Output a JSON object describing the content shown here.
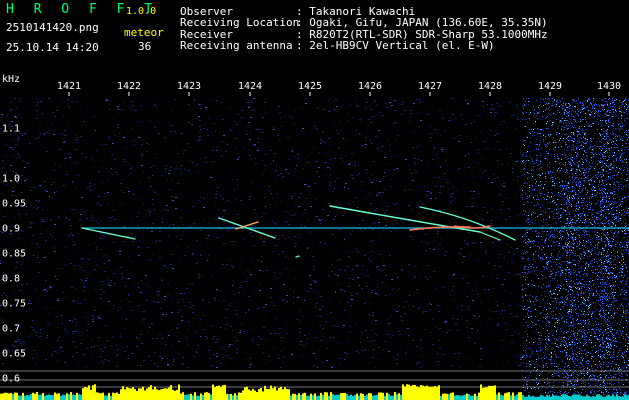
{
  "header": {
    "app_name": "H R O F F T",
    "version": "1.0.0",
    "filename": "2510141420.png",
    "timestamp": "25.10.14 14:20",
    "event_type": "meteor",
    "event_count": "36"
  },
  "info": [
    {
      "label": "Observer",
      "value": ": Takanori Kawachi"
    },
    {
      "label": "Receiving Location",
      "value": ": Ogaki, Gifu, JAPAN (136.60E, 35.35N)"
    },
    {
      "label": "Receiver",
      "value": ": R820T2(RTL-SDR) SDR-Sharp 53.1000MHz"
    },
    {
      "label": "Receiving antenna",
      "value": ": 2el-HB9CV Vertical (el. E-W)"
    }
  ],
  "axes": {
    "unit_label": "kHz",
    "x_ticks": [
      "1421",
      "1422",
      "1423",
      "1424",
      "1425",
      "1426",
      "1427",
      "1428",
      "1429",
      "1430"
    ],
    "y_ticks": [
      "1.1",
      "1.0",
      "0.95",
      "0.9",
      "0.85",
      "0.8",
      "0.75",
      "0.7",
      "0.65",
      "0.6"
    ]
  },
  "colors": {
    "background": "#000000",
    "noise": "#1a2a8a",
    "carrier": "#22ccff",
    "trace": "#66ffcc",
    "trace_hot": "#ff7755",
    "header_green": "#00ff66",
    "header_yellow": "#ffff00",
    "bottom_yellow": "#ffff00",
    "bottom_cyan": "#00ffff"
  }
}
